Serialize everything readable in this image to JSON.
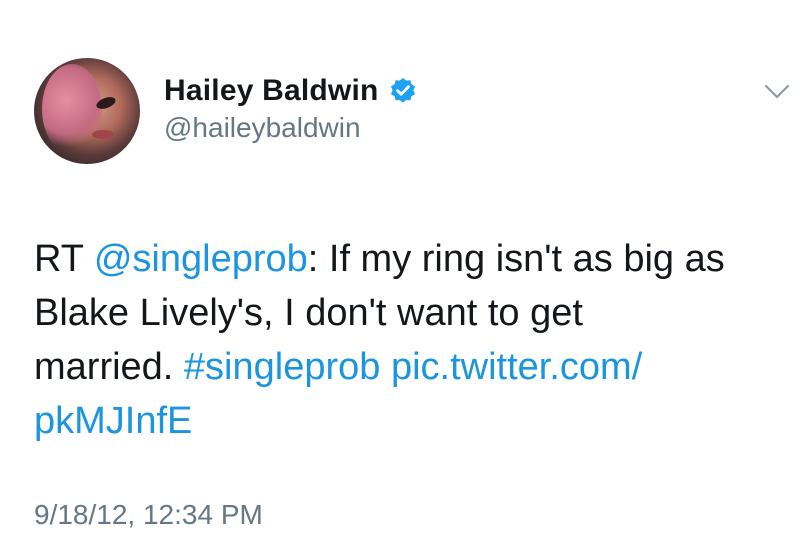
{
  "author": {
    "display_name": "Hailey Baldwin",
    "handle": "@haileybaldwin",
    "verified": true,
    "avatar_icon": "profile-photo",
    "verified_icon": "verified-badge-icon",
    "verified_color": "#1da1f2"
  },
  "menu": {
    "icon": "chevron-down-icon"
  },
  "tweet": {
    "line1_prefix": "RT ",
    "mention": "@singleprob",
    "line1_suffix": ": If my ring isn't as big as",
    "line2": "Blake Lively's, I don't want to get",
    "line3_prefix": "married. ",
    "hashtag": "#singleprob",
    "link_part1": "pic.twitter.com/",
    "link_part2": "pkMJInfE",
    "timestamp": "9/18/12, 12:34 PM"
  },
  "colors": {
    "link": "#1b95e0",
    "text": "#14171a",
    "muted": "#657786",
    "background": "#ffffff"
  }
}
